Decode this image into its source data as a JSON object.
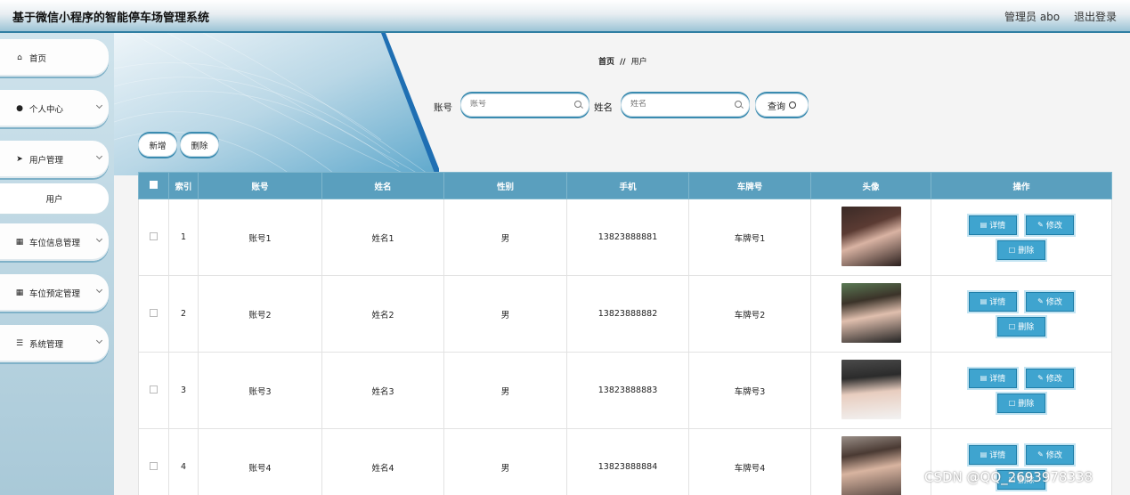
{
  "header": {
    "title": "基于微信小程序的智能停车场管理系统",
    "admin": "管理员 abo",
    "logout": "退出登录"
  },
  "sidebar": {
    "items": [
      {
        "label": "首页",
        "icon": "home-icon"
      },
      {
        "label": "个人中心",
        "icon": "user-icon"
      },
      {
        "label": "用户管理",
        "icon": "send-icon"
      },
      {
        "label": "用户",
        "icon": ""
      },
      {
        "label": "车位信息管理",
        "icon": "grid-icon"
      },
      {
        "label": "车位预定管理",
        "icon": "grid-icon"
      },
      {
        "label": "系统管理",
        "icon": "list-icon"
      }
    ]
  },
  "breadcrumb": {
    "home": "首页",
    "sep": "//",
    "current": "用户"
  },
  "search": {
    "account_label": "账号",
    "account_placeholder": "账号",
    "name_label": "姓名",
    "name_placeholder": "姓名",
    "query_label": "查询"
  },
  "actions": {
    "add": "新增",
    "delete": "删除"
  },
  "table": {
    "headers": [
      "",
      "索引",
      "账号",
      "姓名",
      "性别",
      "手机",
      "车牌号",
      "头像",
      "操作"
    ],
    "rows": [
      {
        "index": "1",
        "account": "账号1",
        "name": "姓名1",
        "gender": "男",
        "phone": "13823888881",
        "plate": "车牌号1"
      },
      {
        "index": "2",
        "account": "账号2",
        "name": "姓名2",
        "gender": "男",
        "phone": "13823888882",
        "plate": "车牌号2"
      },
      {
        "index": "3",
        "account": "账号3",
        "name": "姓名3",
        "gender": "男",
        "phone": "13823888883",
        "plate": "车牌号3"
      },
      {
        "index": "4",
        "account": "账号4",
        "name": "姓名4",
        "gender": "男",
        "phone": "13823888884",
        "plate": "车牌号4"
      }
    ],
    "ops": {
      "detail": "详情",
      "edit": "修改",
      "delete": "删除"
    }
  },
  "watermark": "CSDN @QQ_2693978338",
  "colors": {
    "accent": "#3fa4cf",
    "header_blue": "#5a9fbe",
    "border_blue": "#3a8bb0"
  }
}
